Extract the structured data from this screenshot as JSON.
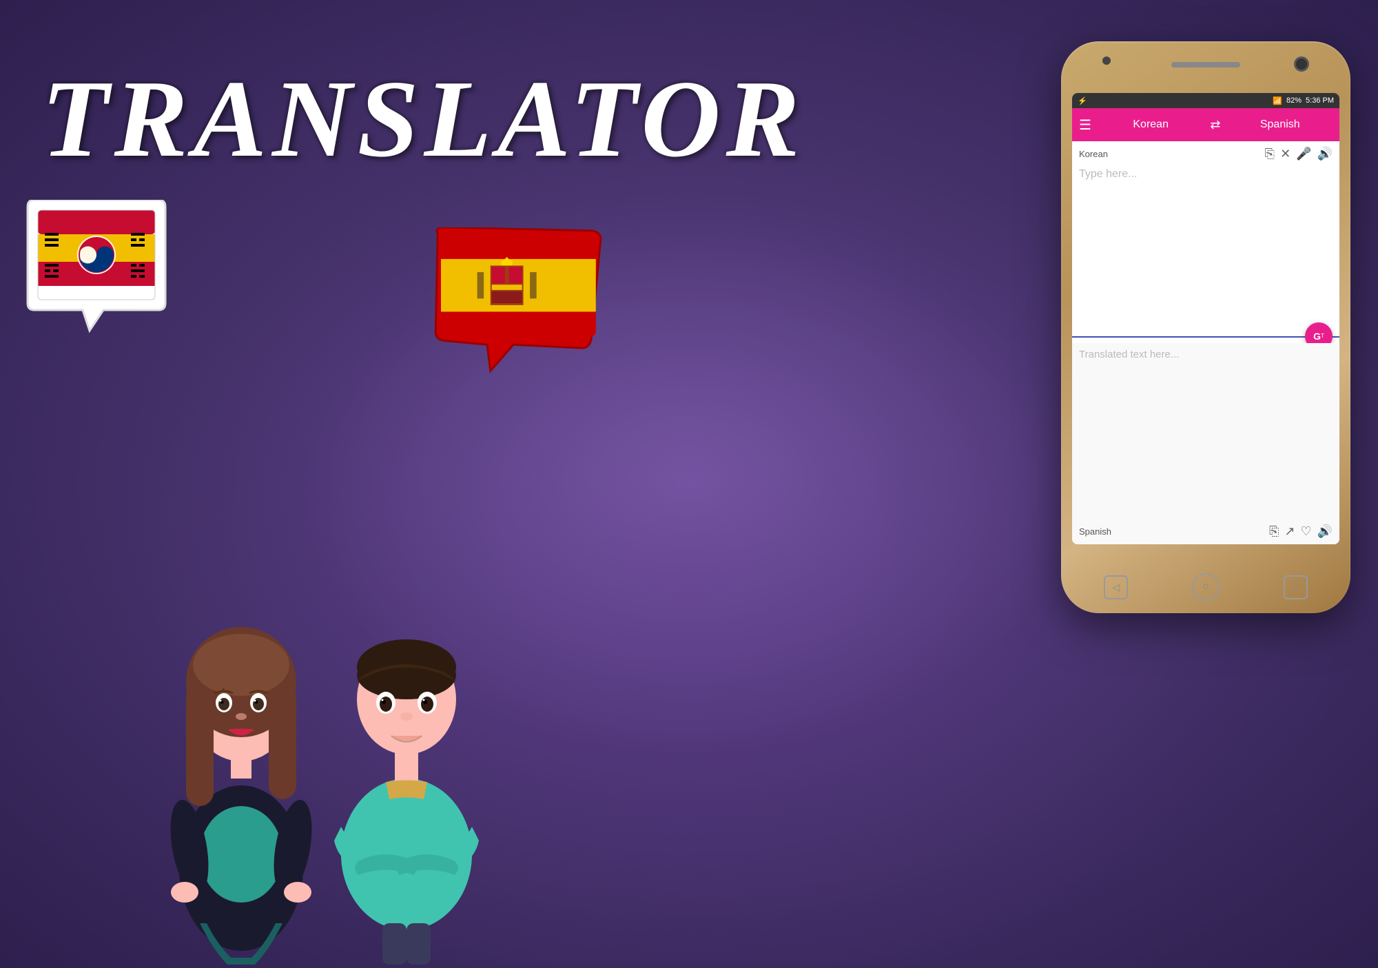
{
  "title": "TRANSLATOR",
  "app": {
    "source_language": "Korean",
    "target_language": "Spanish",
    "toolbar_menu_icon": "☰",
    "swap_icon": "⇄",
    "source_placeholder": "Type here...",
    "target_placeholder": "Translated text here...",
    "source_icons": [
      "📋",
      "✕",
      "🎤",
      "🔊"
    ],
    "target_icons": [
      "📋",
      "↗",
      "♡",
      "🔊"
    ],
    "translate_button": "G",
    "status_time": "5:36 PM",
    "status_battery": "82%",
    "status_signal": "📶"
  },
  "bubbles": {
    "korean_flag_alt": "Korean flag",
    "spanish_flag_alt": "Spanish flag"
  },
  "characters": {
    "female_alt": "Female character",
    "male_alt": "Male character"
  }
}
